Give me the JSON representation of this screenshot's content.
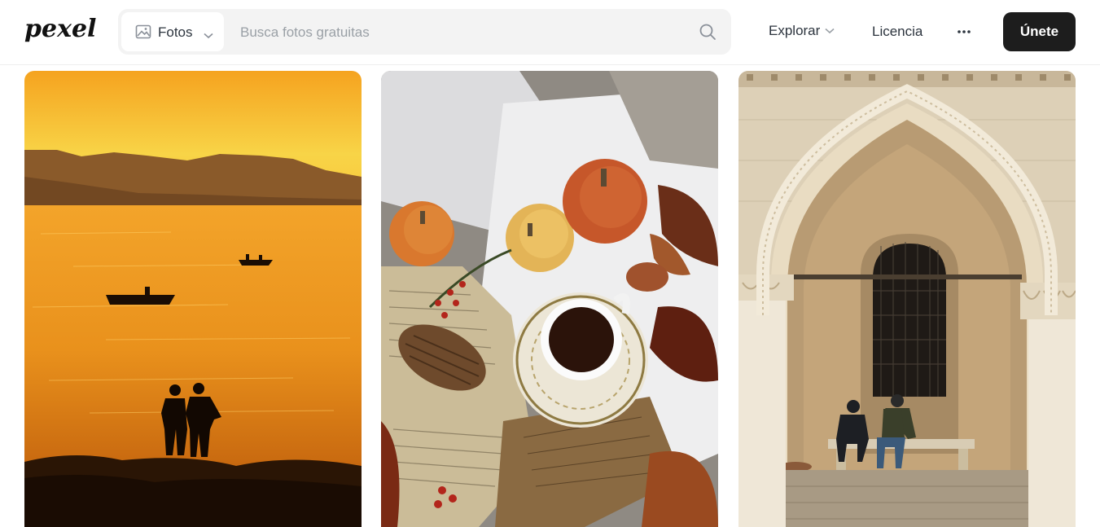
{
  "header": {
    "logo_text": "pexels",
    "media_type_selector": {
      "selected": "Fotos",
      "icon": "image-icon"
    },
    "search": {
      "placeholder": "Busca fotos gratuitas",
      "value": "",
      "icon": "search-icon"
    },
    "nav": {
      "explore_label": "Explorar",
      "license_label": "Licencia",
      "more_icon": "more-horizontal-icon",
      "join_label": "Únete"
    }
  },
  "colors": {
    "join_button_bg": "#1d1d1d",
    "search_bg": "#f3f3f3",
    "text": "#2c343e",
    "placeholder": "#9aa0a6"
  },
  "gallery": {
    "photos": [
      {
        "subject": "sunset-sea-silhouettes"
      },
      {
        "subject": "autumn-coffee-flatlay"
      },
      {
        "subject": "venetian-gothic-arch"
      }
    ]
  }
}
